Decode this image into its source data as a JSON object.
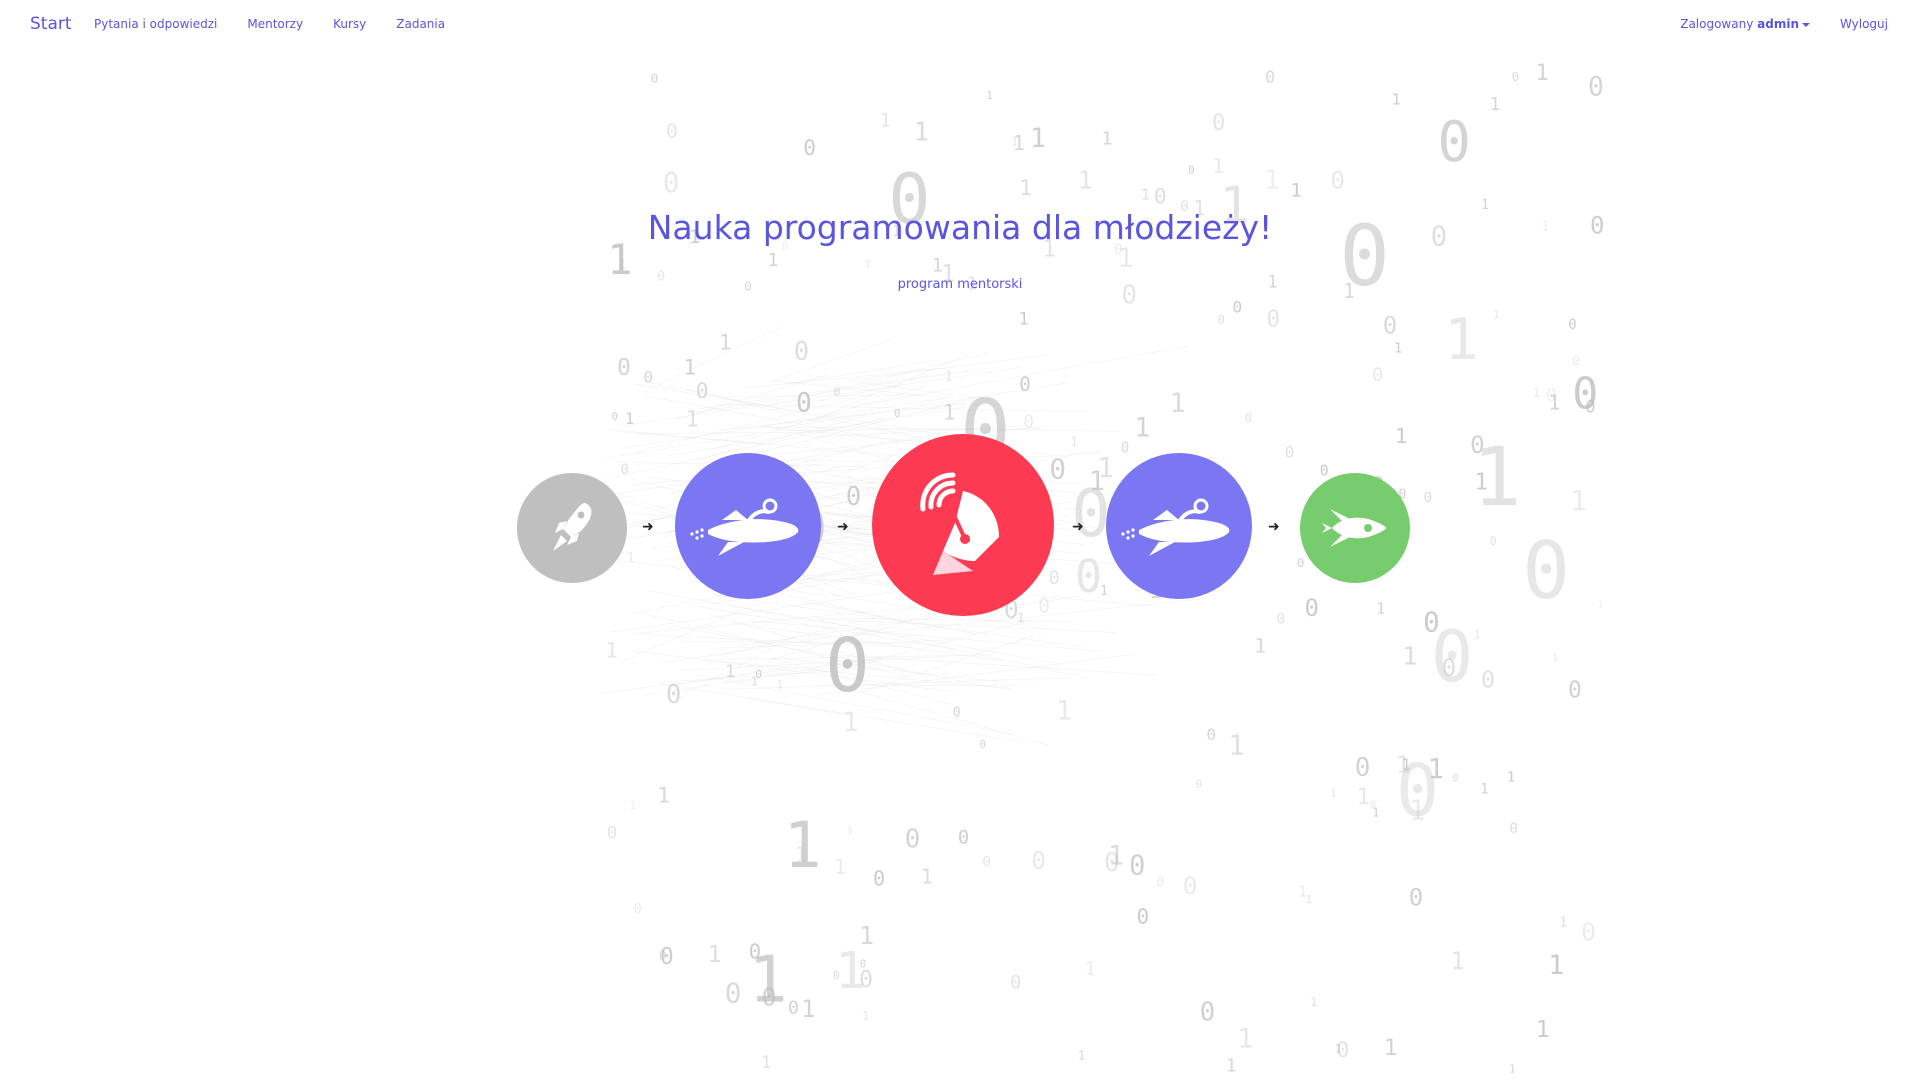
{
  "navbar": {
    "brand": "Start",
    "links": [
      "Pytania i odpowiedzi",
      "Mentorzy",
      "Kursy",
      "Zadania"
    ],
    "logged_prefix": "Zalogowany",
    "user": "admin",
    "logout": "Wyloguj"
  },
  "hero": {
    "title": "Nauka programowania dla młodzieży!",
    "subtitle": "program mentorski"
  },
  "steps": [
    {
      "icon": "rocket-icon",
      "color": "#bfbfbf"
    },
    {
      "icon": "rocket-rider-icon",
      "color": "#7b76f2"
    },
    {
      "icon": "satellite-dish-icon",
      "color": "#fc3a52"
    },
    {
      "icon": "rocket-rider-icon",
      "color": "#7b76f2"
    },
    {
      "icon": "rocket-ship-icon",
      "color": "#77cc6d"
    }
  ],
  "arrow_glyph": "➜",
  "colors": {
    "accent": "#5a55e0"
  }
}
